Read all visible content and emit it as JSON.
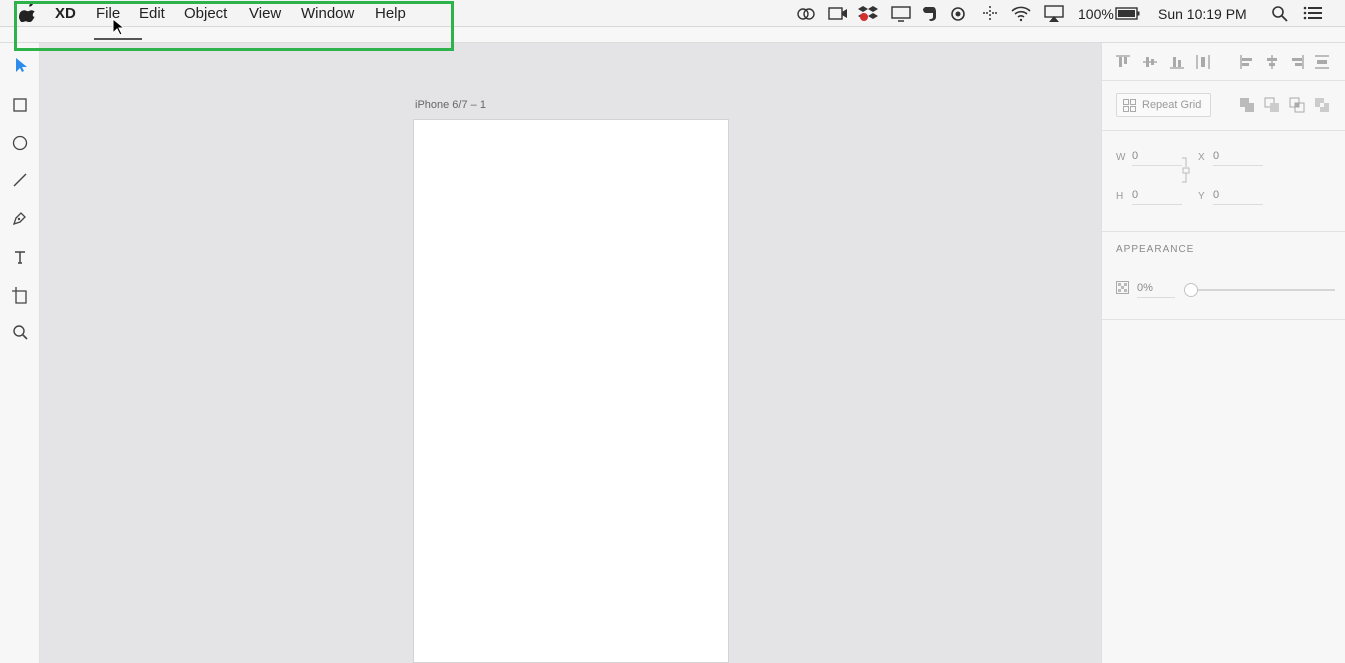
{
  "menubar": {
    "app_name": "XD",
    "menus": [
      "File",
      "Edit",
      "Object",
      "View",
      "Window",
      "Help"
    ],
    "battery_percent": "100%",
    "clock": "Sun 10:19 PM",
    "status_icons": [
      "creative-cloud-icon",
      "video-camera-icon",
      "dropbox-icon",
      "display-icon",
      "evernote-icon",
      "sync-icon",
      "grid-dots-icon",
      "wifi-icon",
      "airplay-icon",
      "battery-icon",
      "spotlight-search-icon",
      "notification-list-icon"
    ]
  },
  "toolbar": {
    "tools": [
      "select-arrow-icon",
      "rectangle-icon",
      "ellipse-icon",
      "line-icon",
      "pen-icon",
      "text-icon",
      "artboard-icon",
      "zoom-icon"
    ]
  },
  "canvas": {
    "artboard_label": "iPhone 6/7 – 1"
  },
  "panel": {
    "repeat_grid_label": "Repeat Grid",
    "w_label": "W",
    "w_value": "0",
    "h_label": "H",
    "h_value": "0",
    "x_label": "X",
    "x_value": "0",
    "y_label": "Y",
    "y_value": "0",
    "appearance_title": "APPEARANCE",
    "opacity_value": "0%"
  },
  "colors": {
    "highlight": "#2eb34a",
    "select_tool": "#2d8ceb",
    "canvas_bg": "#e4e3e6"
  }
}
